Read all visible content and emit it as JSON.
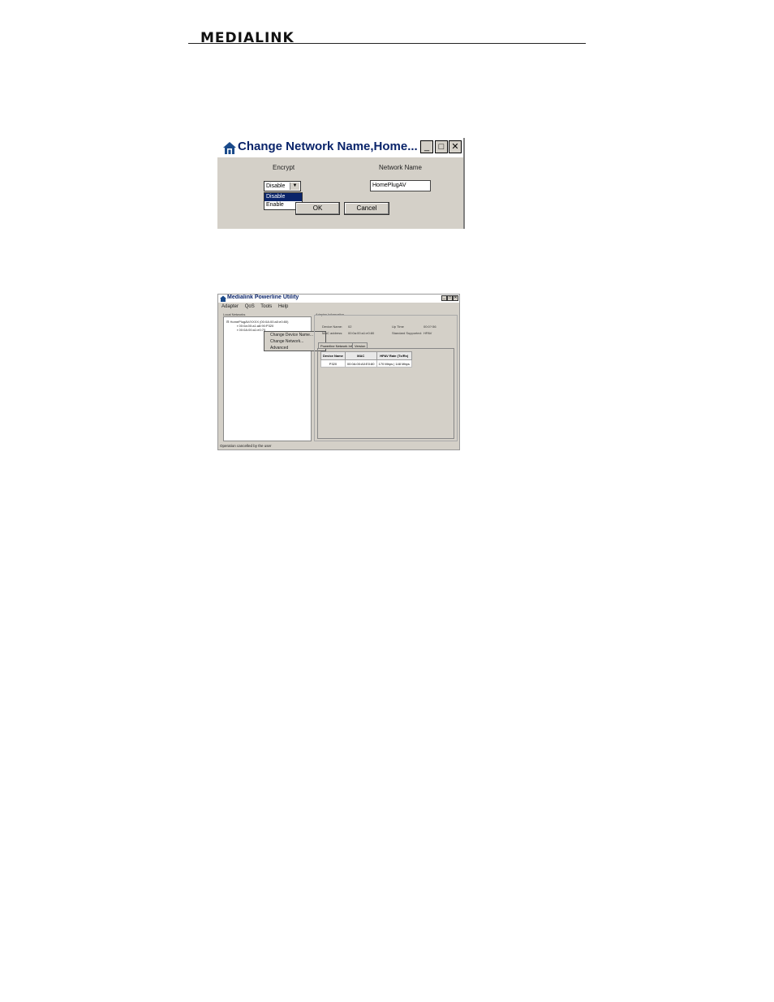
{
  "header": {
    "logo_text": "MEDIALINK"
  },
  "dialog": {
    "title": "Change Network Name,Home...",
    "minimize_glyph": "_",
    "maximize_glyph": "□",
    "close_glyph": "✕",
    "encrypt_label": "Encrypt",
    "network_name_label": "Network Name",
    "encrypt_value": "Disable",
    "encrypt_options": [
      "Disable",
      "Enable"
    ],
    "encrypt_highlighted": "Disable",
    "network_name_value": "HomePlugAV",
    "ok_label": "OK",
    "cancel_label": "Cancel"
  },
  "app": {
    "title": "Medialink Powerline Utility",
    "menu": [
      "Adapter",
      "QoS",
      "Tools",
      "Help"
    ],
    "local_networks_label": "Local Networks",
    "tree": {
      "root": "HomePlugAV/XXXX (00:0A:00:a0:e0:80)",
      "child_1": "00:0a:00:a1:a8:90:P320",
      "child_2_selected": "00:0A:00:a1:e0:70"
    },
    "context_menu": [
      "Change Device Name...",
      "Change Network...",
      "Advanced"
    ],
    "adapter_info_label": "Adapter Information",
    "info": {
      "device_name_label": "Device Name:",
      "device_name_value": "02",
      "mac_label": "MAC address:",
      "mac_value": "00:0a:00:a1:e0:80",
      "uptime_label": "Up Time",
      "uptime_value": "00:0?:56",
      "standard_label": "Standard Supported:",
      "standard_value": "HPAV"
    },
    "tabs": [
      "Powerline Network Info",
      "Version"
    ],
    "table_headers": [
      "Device Name",
      "MAC",
      "HPAV Rate (Tx/Rx)"
    ],
    "table_rows": [
      [
        "P320",
        "00:0A:00:A0:E0:80",
        "170 Mbps | 148 Mbps"
      ]
    ],
    "status": "Operation cancelled by the user"
  }
}
